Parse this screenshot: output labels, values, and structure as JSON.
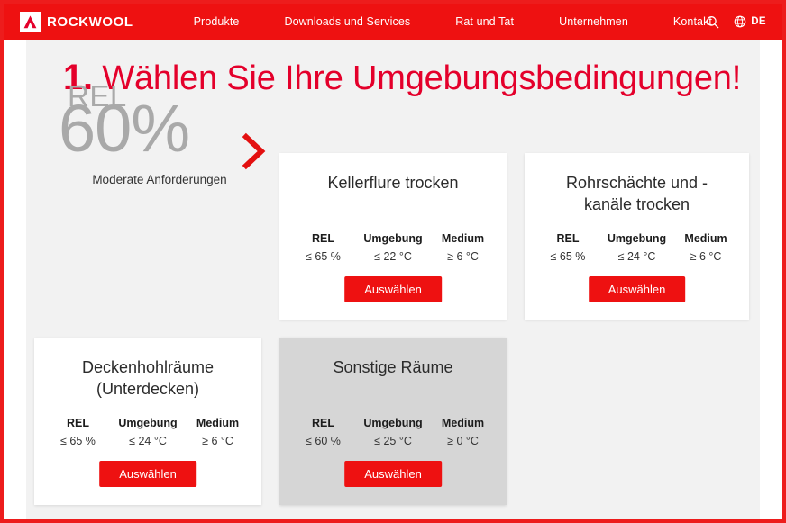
{
  "navbar": {
    "brand_name": "ROCKWOOL",
    "brand_icon": "rockwool-logo-icon",
    "links": [
      {
        "label": "Produkte"
      },
      {
        "label": "Downloads und Services"
      },
      {
        "label": "Rat und Tat"
      },
      {
        "label": "Unternehmen"
      },
      {
        "label": "Kontakt"
      }
    ],
    "search_icon": "search-icon",
    "globe_icon": "globe-icon",
    "language_code": "DE",
    "background_color": "#ee1111"
  },
  "page": {
    "step_number": "1.",
    "headline": "Wählen Sie Ihre Umgebungsbedingungen!",
    "headline_color": "#e4002b",
    "background_color": "#f2f2f2"
  },
  "rel_summary": {
    "label": "REL",
    "value": "60%",
    "caption": "Moderate Anforderungen",
    "chevron_icon": "chevron-right-icon",
    "chevron_color": "#e31010",
    "value_color": "#a9a9a9"
  },
  "stat_headers": {
    "rel": "REL",
    "umgebung": "Umgebung",
    "medium": "Medium"
  },
  "cards": [
    {
      "title": "Kellerflure trocken",
      "rel": "≤ 65 %",
      "umgebung": "≤ 22 °C",
      "medium": "≥ 6 °C",
      "button_label": "Auswählen",
      "active": false
    },
    {
      "title": "Rohrschächte und -\nkanäle trocken",
      "rel": "≤ 65 %",
      "umgebung": "≤ 24 °C",
      "medium": "≥ 6 °C",
      "button_label": "Auswählen",
      "active": false
    },
    {
      "title": "Deckenhohlräume\n(Unterdecken)",
      "rel": "≤ 65 %",
      "umgebung": "≤ 24 °C",
      "medium": "≥ 6 °C",
      "button_label": "Auswählen",
      "active": false
    },
    {
      "title": "Sonstige Räume",
      "rel": "≤ 60 %",
      "umgebung": "≤ 25 °C",
      "medium": "≥ 0 °C",
      "button_label": "Auswählen",
      "active": true
    }
  ]
}
